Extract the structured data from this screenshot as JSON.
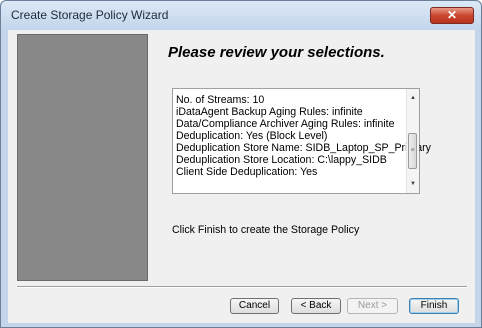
{
  "window": {
    "title": "Create Storage Policy Wizard"
  },
  "page": {
    "heading": "Please review your selections.",
    "summary_lines": [
      "No. of Streams: 10",
      "iDataAgent Backup Aging Rules: infinite",
      "Data/Compliance Archiver Aging Rules: infinite",
      "Deduplication: Yes (Block Level)",
      "Deduplication Store Name:  SIDB_Laptop_SP_Primary",
      "Deduplication Store Location:  C:\\lappy_SIDB",
      "Client Side Deduplication:  Yes"
    ],
    "instruction": "Click Finish to create the Storage Policy"
  },
  "buttons": {
    "cancel": "Cancel",
    "back": "< Back",
    "next": "Next >",
    "finish": "Finish"
  },
  "icons": {
    "close": "close-icon",
    "scroll_up": "scroll-up-arrow-icon",
    "scroll_down": "scroll-down-arrow-icon",
    "scroll_thumb_grip": "grip-icon"
  },
  "colors": {
    "window_frame": "#c4d5ea",
    "close_button": "#c9472f",
    "side_panel": "#888888"
  }
}
